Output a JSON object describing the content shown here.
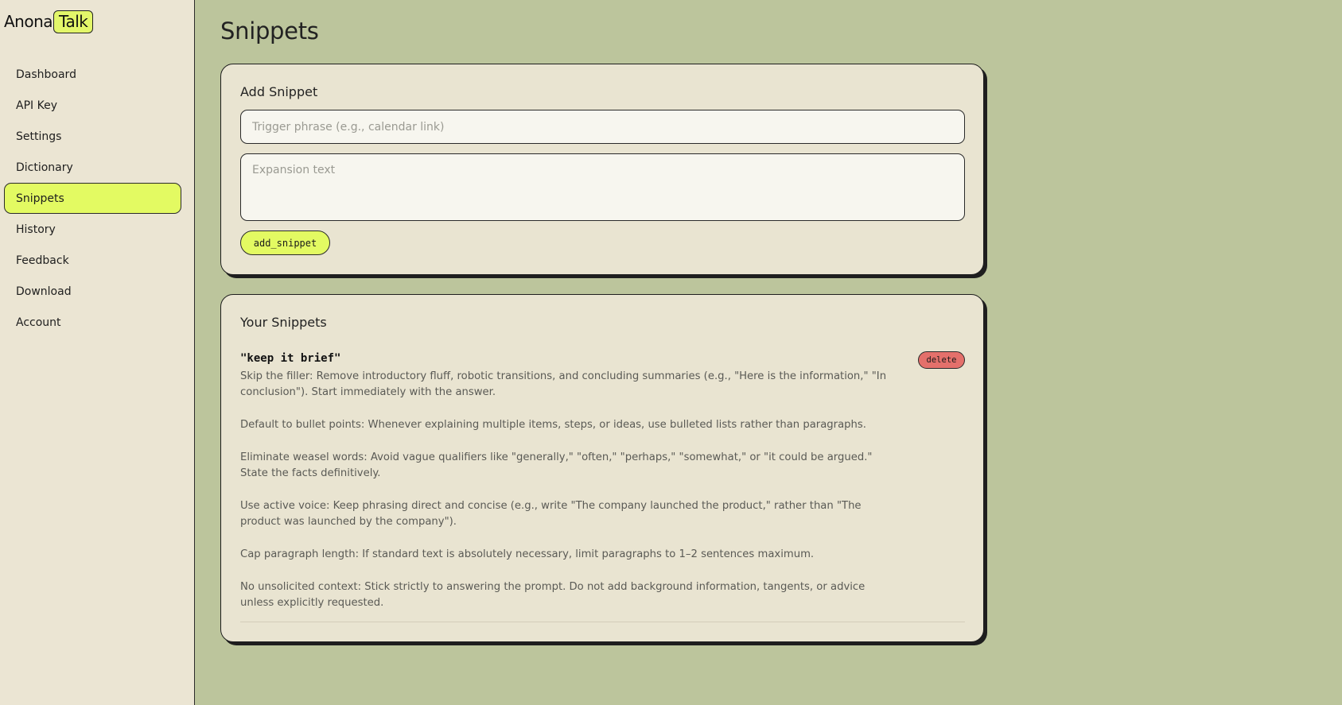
{
  "app": {
    "logo_part1": "Anona",
    "logo_part2": "Talk"
  },
  "sidebar": {
    "items": [
      {
        "label": "Dashboard"
      },
      {
        "label": "API Key"
      },
      {
        "label": "Settings"
      },
      {
        "label": "Dictionary"
      },
      {
        "label": "Snippets",
        "active": true
      },
      {
        "label": "History"
      },
      {
        "label": "Feedback"
      },
      {
        "label": "Download"
      },
      {
        "label": "Account"
      }
    ]
  },
  "page": {
    "title": "Snippets"
  },
  "add_snippet": {
    "heading": "Add Snippet",
    "trigger_placeholder": "Trigger phrase (e.g., calendar link)",
    "expansion_placeholder": "Expansion text",
    "button_label": "add_snippet"
  },
  "snippets_list": {
    "heading": "Your Snippets",
    "items": [
      {
        "trigger": "\"keep it brief\"",
        "delete_label": "delete",
        "paragraphs": [
          "Skip the filler: Remove introductory fluff, robotic transitions, and concluding summaries (e.g., \"Here is the information,\" \"In conclusion\"). Start immediately with the answer.",
          "Default to bullet points: Whenever explaining multiple items, steps, or ideas, use bulleted lists rather than paragraphs.",
          "Eliminate weasel words: Avoid vague qualifiers like \"generally,\" \"often,\" \"perhaps,\" \"somewhat,\" or \"it could be argued.\" State the facts definitively.",
          "Use active voice: Keep phrasing direct and concise (e.g., write \"The company launched the product,\" rather than \"The product was launched by the company\").",
          "Cap paragraph length: If standard text is absolutely necessary, limit paragraphs to 1–2 sentences maximum.",
          "No unsolicited context: Stick strictly to answering the prompt. Do not add background information, tangents, or advice unless explicitly requested."
        ]
      }
    ]
  },
  "colors": {
    "background": "#bcc59c",
    "sidebar": "#ebe5d3",
    "accent": "#e3fa62",
    "card": "#e9e4d1",
    "danger": "#e4706b"
  }
}
